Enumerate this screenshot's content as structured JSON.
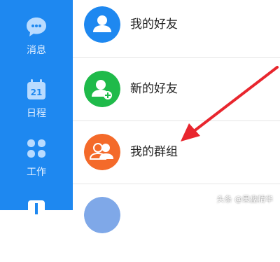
{
  "sidebar": {
    "items": [
      {
        "label": "消息",
        "icon": "chat-bubble-icon"
      },
      {
        "label": "日程",
        "icon": "calendar-icon",
        "date": "21"
      },
      {
        "label": "工作",
        "icon": "apps-grid-icon"
      },
      {
        "label": "",
        "icon": "plus-icon"
      }
    ]
  },
  "main": {
    "rows": [
      {
        "label": "我的好友",
        "avatar_color": "#1e88f0",
        "icon": "person-icon"
      },
      {
        "label": "新的好友",
        "avatar_color": "#1fba4a",
        "icon": "add-person-icon"
      },
      {
        "label": "我的群组",
        "avatar_color": "#f46a2a",
        "icon": "group-icon"
      },
      {
        "label": "",
        "avatar_color": "#7fa8e8",
        "icon": "partial-icon"
      }
    ]
  },
  "annotation": {
    "arrow_color": "#e8262e"
  },
  "watermark": "头条 @果盘精华",
  "colors": {
    "sidebar_bg": "#1e88f0",
    "divider": "#e6e6e6"
  }
}
